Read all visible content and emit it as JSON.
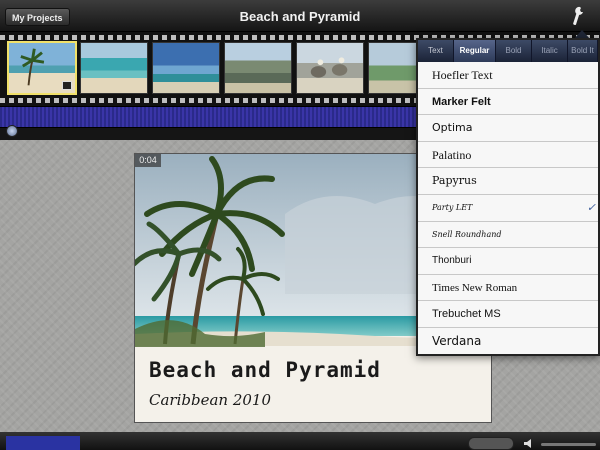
{
  "toolbar": {
    "my_projects_label": "My Projects",
    "project_title": "Beach and Pyramid",
    "settings_icon": "wrench-icon"
  },
  "filmstrip": {
    "clips": [
      {
        "name": "beach-palm",
        "selected": true
      },
      {
        "name": "beach-water"
      },
      {
        "name": "shore-sky"
      },
      {
        "name": "rocks-coast"
      },
      {
        "name": "pelicans"
      },
      {
        "name": "pelican"
      }
    ]
  },
  "viewer": {
    "timecode": "0:04",
    "title_main": "Beach and Pyramid",
    "title_sub": "Caribbean 2010"
  },
  "font_popover": {
    "tabs": [
      {
        "label": "Text",
        "state": "normal"
      },
      {
        "label": "Regular",
        "state": "active"
      },
      {
        "label": "Bold",
        "state": "dim"
      },
      {
        "label": "Italic",
        "state": "dim"
      },
      {
        "label": "Bold It",
        "state": "dim"
      }
    ],
    "fonts": [
      {
        "label": "Hoefler Text",
        "selected": false
      },
      {
        "label": "Marker Felt",
        "selected": false
      },
      {
        "label": "Optima",
        "selected": false
      },
      {
        "label": "Palatino",
        "selected": false
      },
      {
        "label": "Papyrus",
        "selected": false
      },
      {
        "label": "Party LET",
        "selected": true
      },
      {
        "label": "Snell Roundhand",
        "selected": false
      },
      {
        "label": "Thonburi",
        "selected": false
      },
      {
        "label": "Times New Roman",
        "selected": false
      },
      {
        "label": "Trebuchet MS",
        "selected": false
      },
      {
        "label": "Verdana",
        "selected": false
      }
    ],
    "check_icon": "✓"
  },
  "colors": {
    "audio_track": "#3a35a8",
    "popover_header": "#2d3a58",
    "selection_outline": "#f1e16a"
  }
}
